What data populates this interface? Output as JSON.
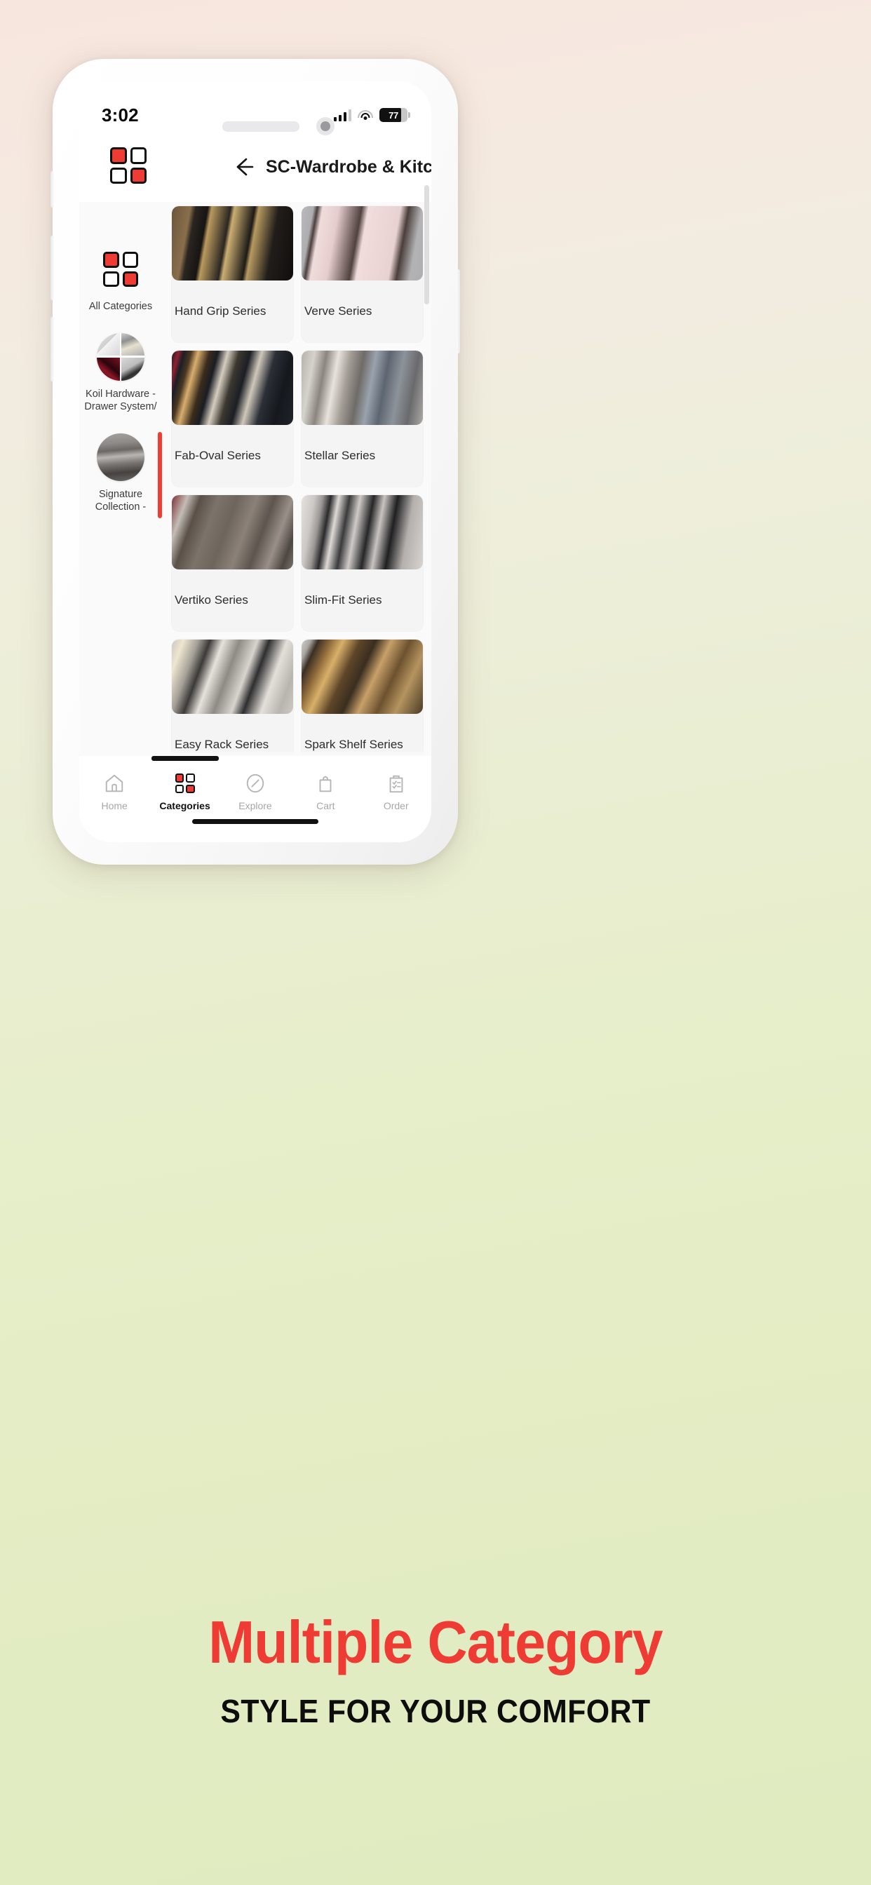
{
  "status_bar": {
    "time": "3:02",
    "battery_percent": "77",
    "signal_icon": "cellular-signal-icon",
    "wifi_icon": "wifi-icon",
    "battery_icon": "battery-icon"
  },
  "header": {
    "logo_icon": "categories-grid-logo",
    "back_icon": "back-arrow-icon",
    "title": "SC-Wardrobe & Kitchen Profiles"
  },
  "sidebar": {
    "items": [
      {
        "label": "All Categories",
        "selected": false,
        "icon": "grid-logo-icon"
      },
      {
        "label": "Koil Hardware - Drawer System/",
        "selected": false,
        "icon": "quad-photo-thumb"
      },
      {
        "label": "Signature Collection -",
        "selected": true,
        "icon": "wardrobe-photo-thumb"
      }
    ]
  },
  "products": [
    {
      "name": "Hand Grip Series",
      "art": "p-handgrip"
    },
    {
      "name": "Verve Series",
      "art": "p-verve"
    },
    {
      "name": "Fab-Oval Series",
      "art": "p-faboval"
    },
    {
      "name": "Stellar Series",
      "art": "p-stellar"
    },
    {
      "name": "Vertiko Series",
      "art": "p-vertiko"
    },
    {
      "name": "Slim-Fit Series",
      "art": "p-slimfit"
    },
    {
      "name": "Easy Rack Series",
      "art": "p-easyrack"
    },
    {
      "name": "Spark Shelf Series",
      "art": "p-spark"
    },
    {
      "name": "",
      "art": "p-light"
    },
    {
      "name": "",
      "art": "p-red"
    }
  ],
  "bottom_nav": {
    "items": [
      {
        "label": "Home",
        "icon": "home-icon",
        "active": false
      },
      {
        "label": "Categories",
        "icon": "grid-icon",
        "active": true
      },
      {
        "label": "Explore",
        "icon": "compass-icon",
        "active": false
      },
      {
        "label": "Cart",
        "icon": "bag-icon",
        "active": false
      },
      {
        "label": "Order",
        "icon": "clipboard-icon",
        "active": false
      }
    ]
  },
  "promo": {
    "title": "Multiple Category",
    "subtitle": "STYLE FOR YOUR COMFORT"
  },
  "colors": {
    "accent_red": "#ee3b33",
    "selection_red": "#f03d33",
    "screen_bg": "#fafafa",
    "card_bg": "#f4f4f4"
  }
}
